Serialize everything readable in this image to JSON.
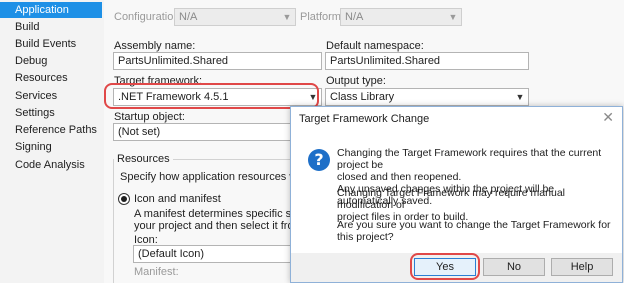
{
  "sidebar": {
    "items": [
      {
        "label": "Application"
      },
      {
        "label": "Build"
      },
      {
        "label": "Build Events"
      },
      {
        "label": "Debug"
      },
      {
        "label": "Resources"
      },
      {
        "label": "Services"
      },
      {
        "label": "Settings"
      },
      {
        "label": "Reference Paths"
      },
      {
        "label": "Signing"
      },
      {
        "label": "Code Analysis"
      }
    ],
    "active_color": "#1e90e6"
  },
  "toolbar": {
    "configuration_label": "Configuration:",
    "configuration_value": "N/A",
    "platform_label": "Platform:",
    "platform_value": "N/A"
  },
  "form": {
    "assembly_name_label": "Assembly name:",
    "assembly_name_value": "PartsUnlimited.Shared",
    "default_namespace_label": "Default namespace:",
    "default_namespace_value": "PartsUnlimited.Shared",
    "target_framework_label": "Target framework:",
    "target_framework_value": ".NET Framework 4.5.1",
    "output_type_label": "Output type:",
    "output_type_value": "Class Library",
    "startup_object_label": "Startup object:",
    "startup_object_value": "(Not set)"
  },
  "resources": {
    "title": "Resources",
    "specify_text": "Specify how application resources will be mana",
    "icon_manifest_label": "Icon and manifest",
    "manifest_desc_1": "A manifest determines specific settings for",
    "manifest_desc_2": "your project and then select it from the list",
    "icon_label": "Icon:",
    "icon_value": "(Default Icon)",
    "manifest_label": "Manifest:"
  },
  "dialog": {
    "title": "Target Framework Change",
    "close_glyph": "✕",
    "info_glyph": "?",
    "msg_1_line_1": "Changing the Target Framework requires that the current project be",
    "msg_1_line_2": "closed and then reopened.",
    "msg_1_line_3": "Any unsaved changes within the project will be automatically saved.",
    "msg_2_line_1": "Changing Target Framework may require manual modification of",
    "msg_2_line_2": "project files in order to build.",
    "msg_3": "Are you sure you want to change the Target Framework for this project?",
    "yes_label": "Yes",
    "no_label": "No",
    "help_label": "Help"
  },
  "colors": {
    "highlight_callout": "#e04848",
    "info_icon": "#1e6fc8"
  }
}
